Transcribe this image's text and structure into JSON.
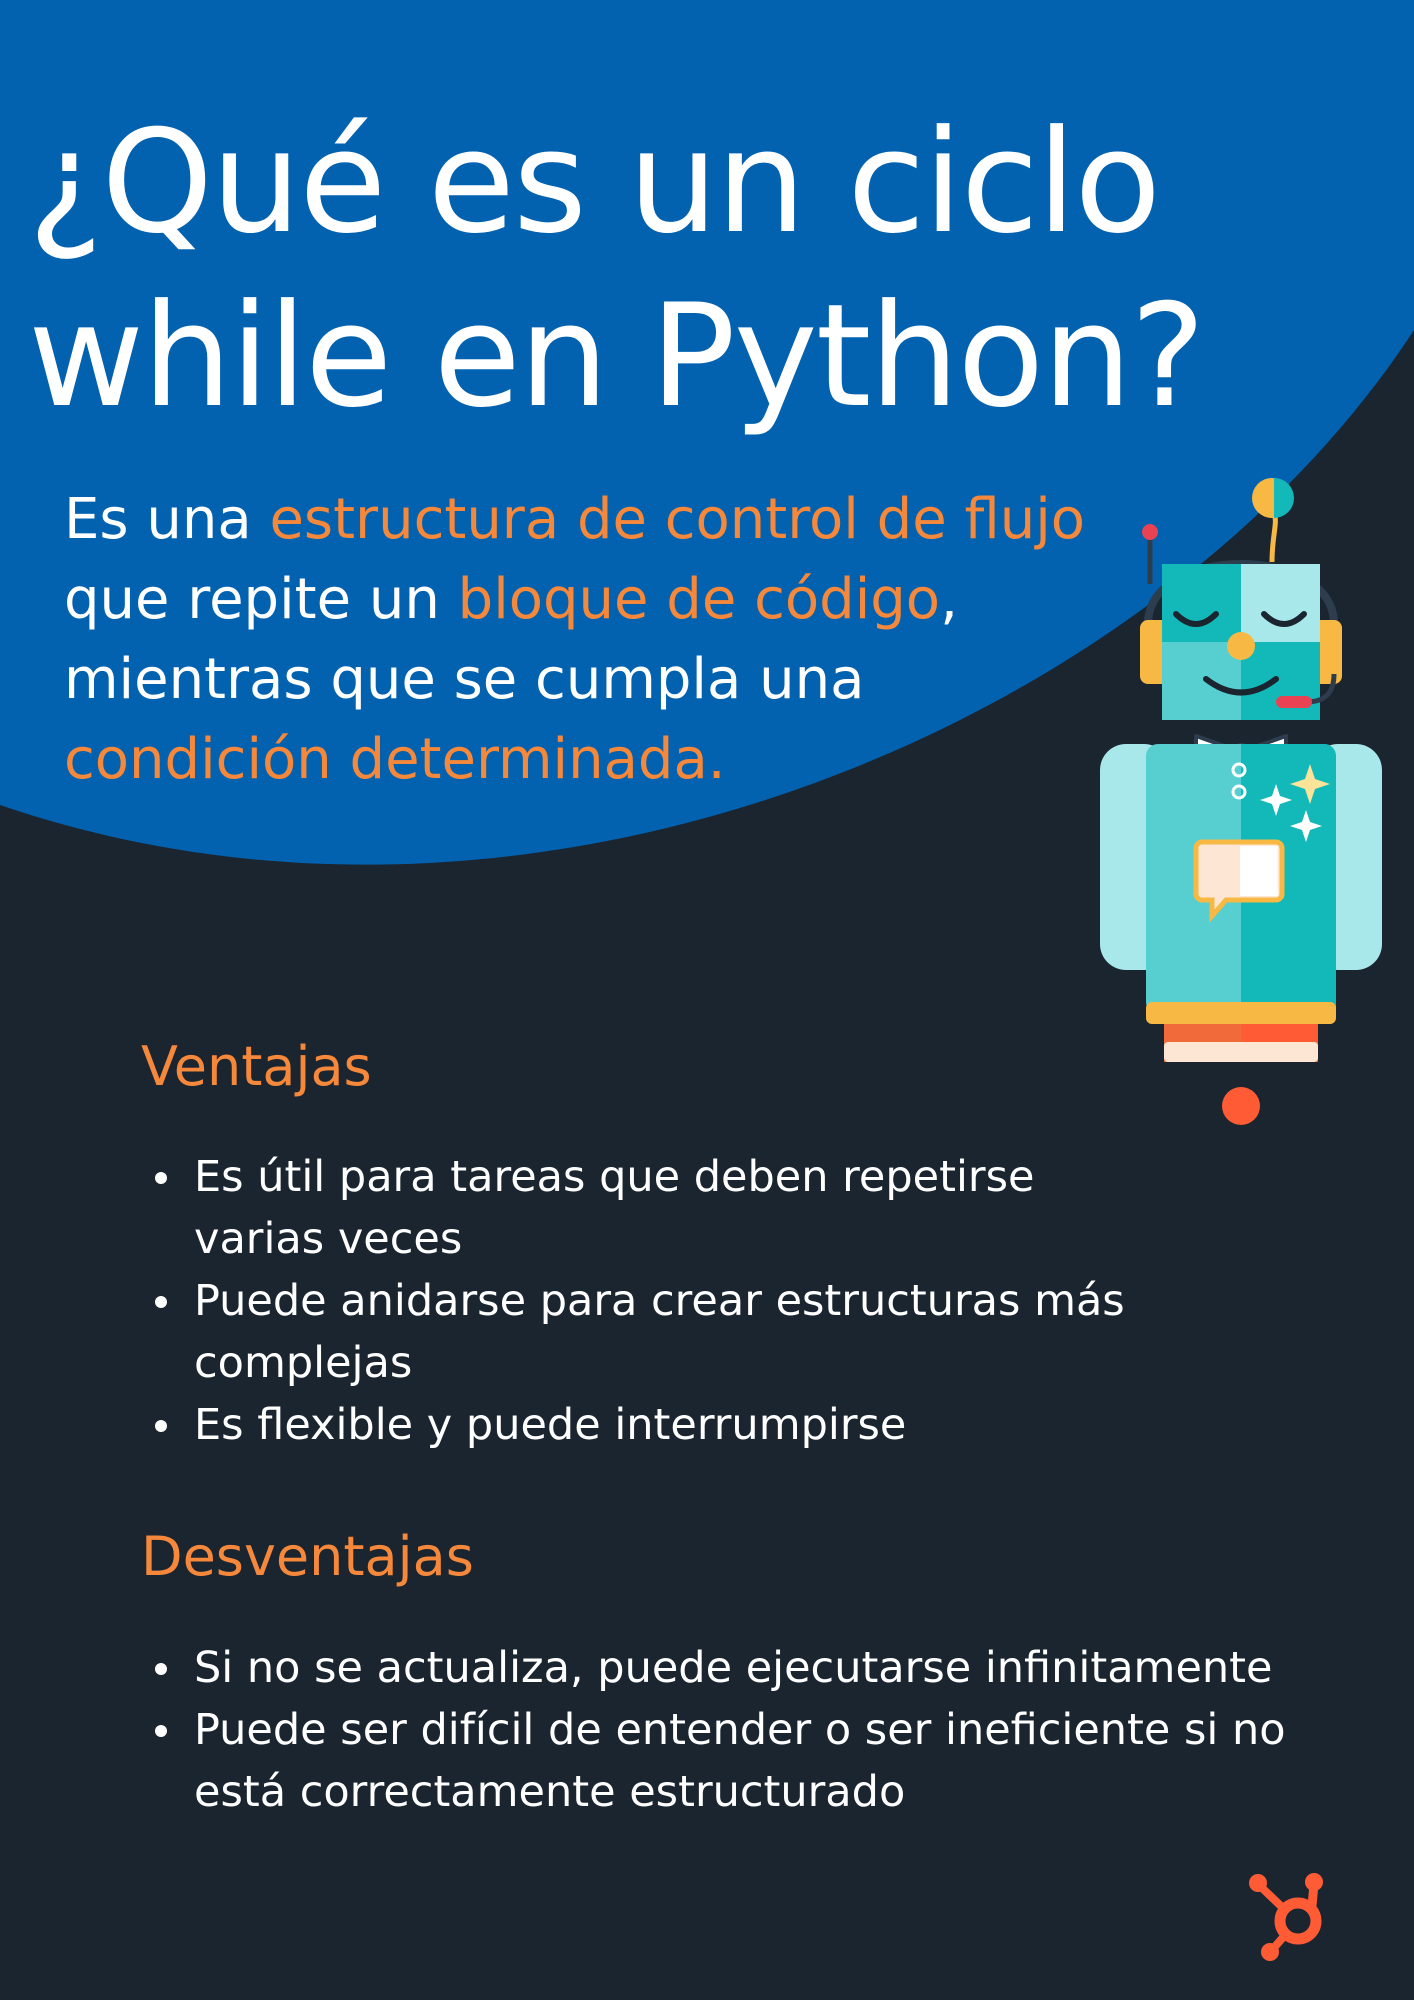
{
  "header": {
    "title_line1": "¿Qué es un ciclo",
    "title_line2": "while en Python?"
  },
  "intro": {
    "line1_plain": "Es una ",
    "line1_highlight": "estructura de control de flujo",
    "line2_plain": "que repite un ",
    "line2_highlight": "bloque de código",
    "line2_end": ",",
    "line3_plain": "mientras que se cumpla una",
    "line4_highlight": "condición determinada."
  },
  "ventajas": {
    "title": "Ventajas",
    "items": [
      "Es útil para tareas que deben repetirse varias veces",
      "Puede anidarse para crear estructuras más complejas",
      "Es flexible y puede interrumpirse"
    ]
  },
  "desventajas": {
    "title": "Desventajas",
    "items": [
      "Si no se actualiza, puede ejecutarse infinitamente",
      "Puede ser difícil de entender o ser ineficiente si no está correctamente estructurado"
    ]
  },
  "icons": {
    "illustration": "robot-icon",
    "logo": "hubspot-logo-icon"
  },
  "colors": {
    "background": "#1a2530",
    "header_blue": "#0262b0",
    "accent_orange": "#f5883a",
    "text": "#ffffff",
    "logo_orange": "#ff5c35"
  }
}
